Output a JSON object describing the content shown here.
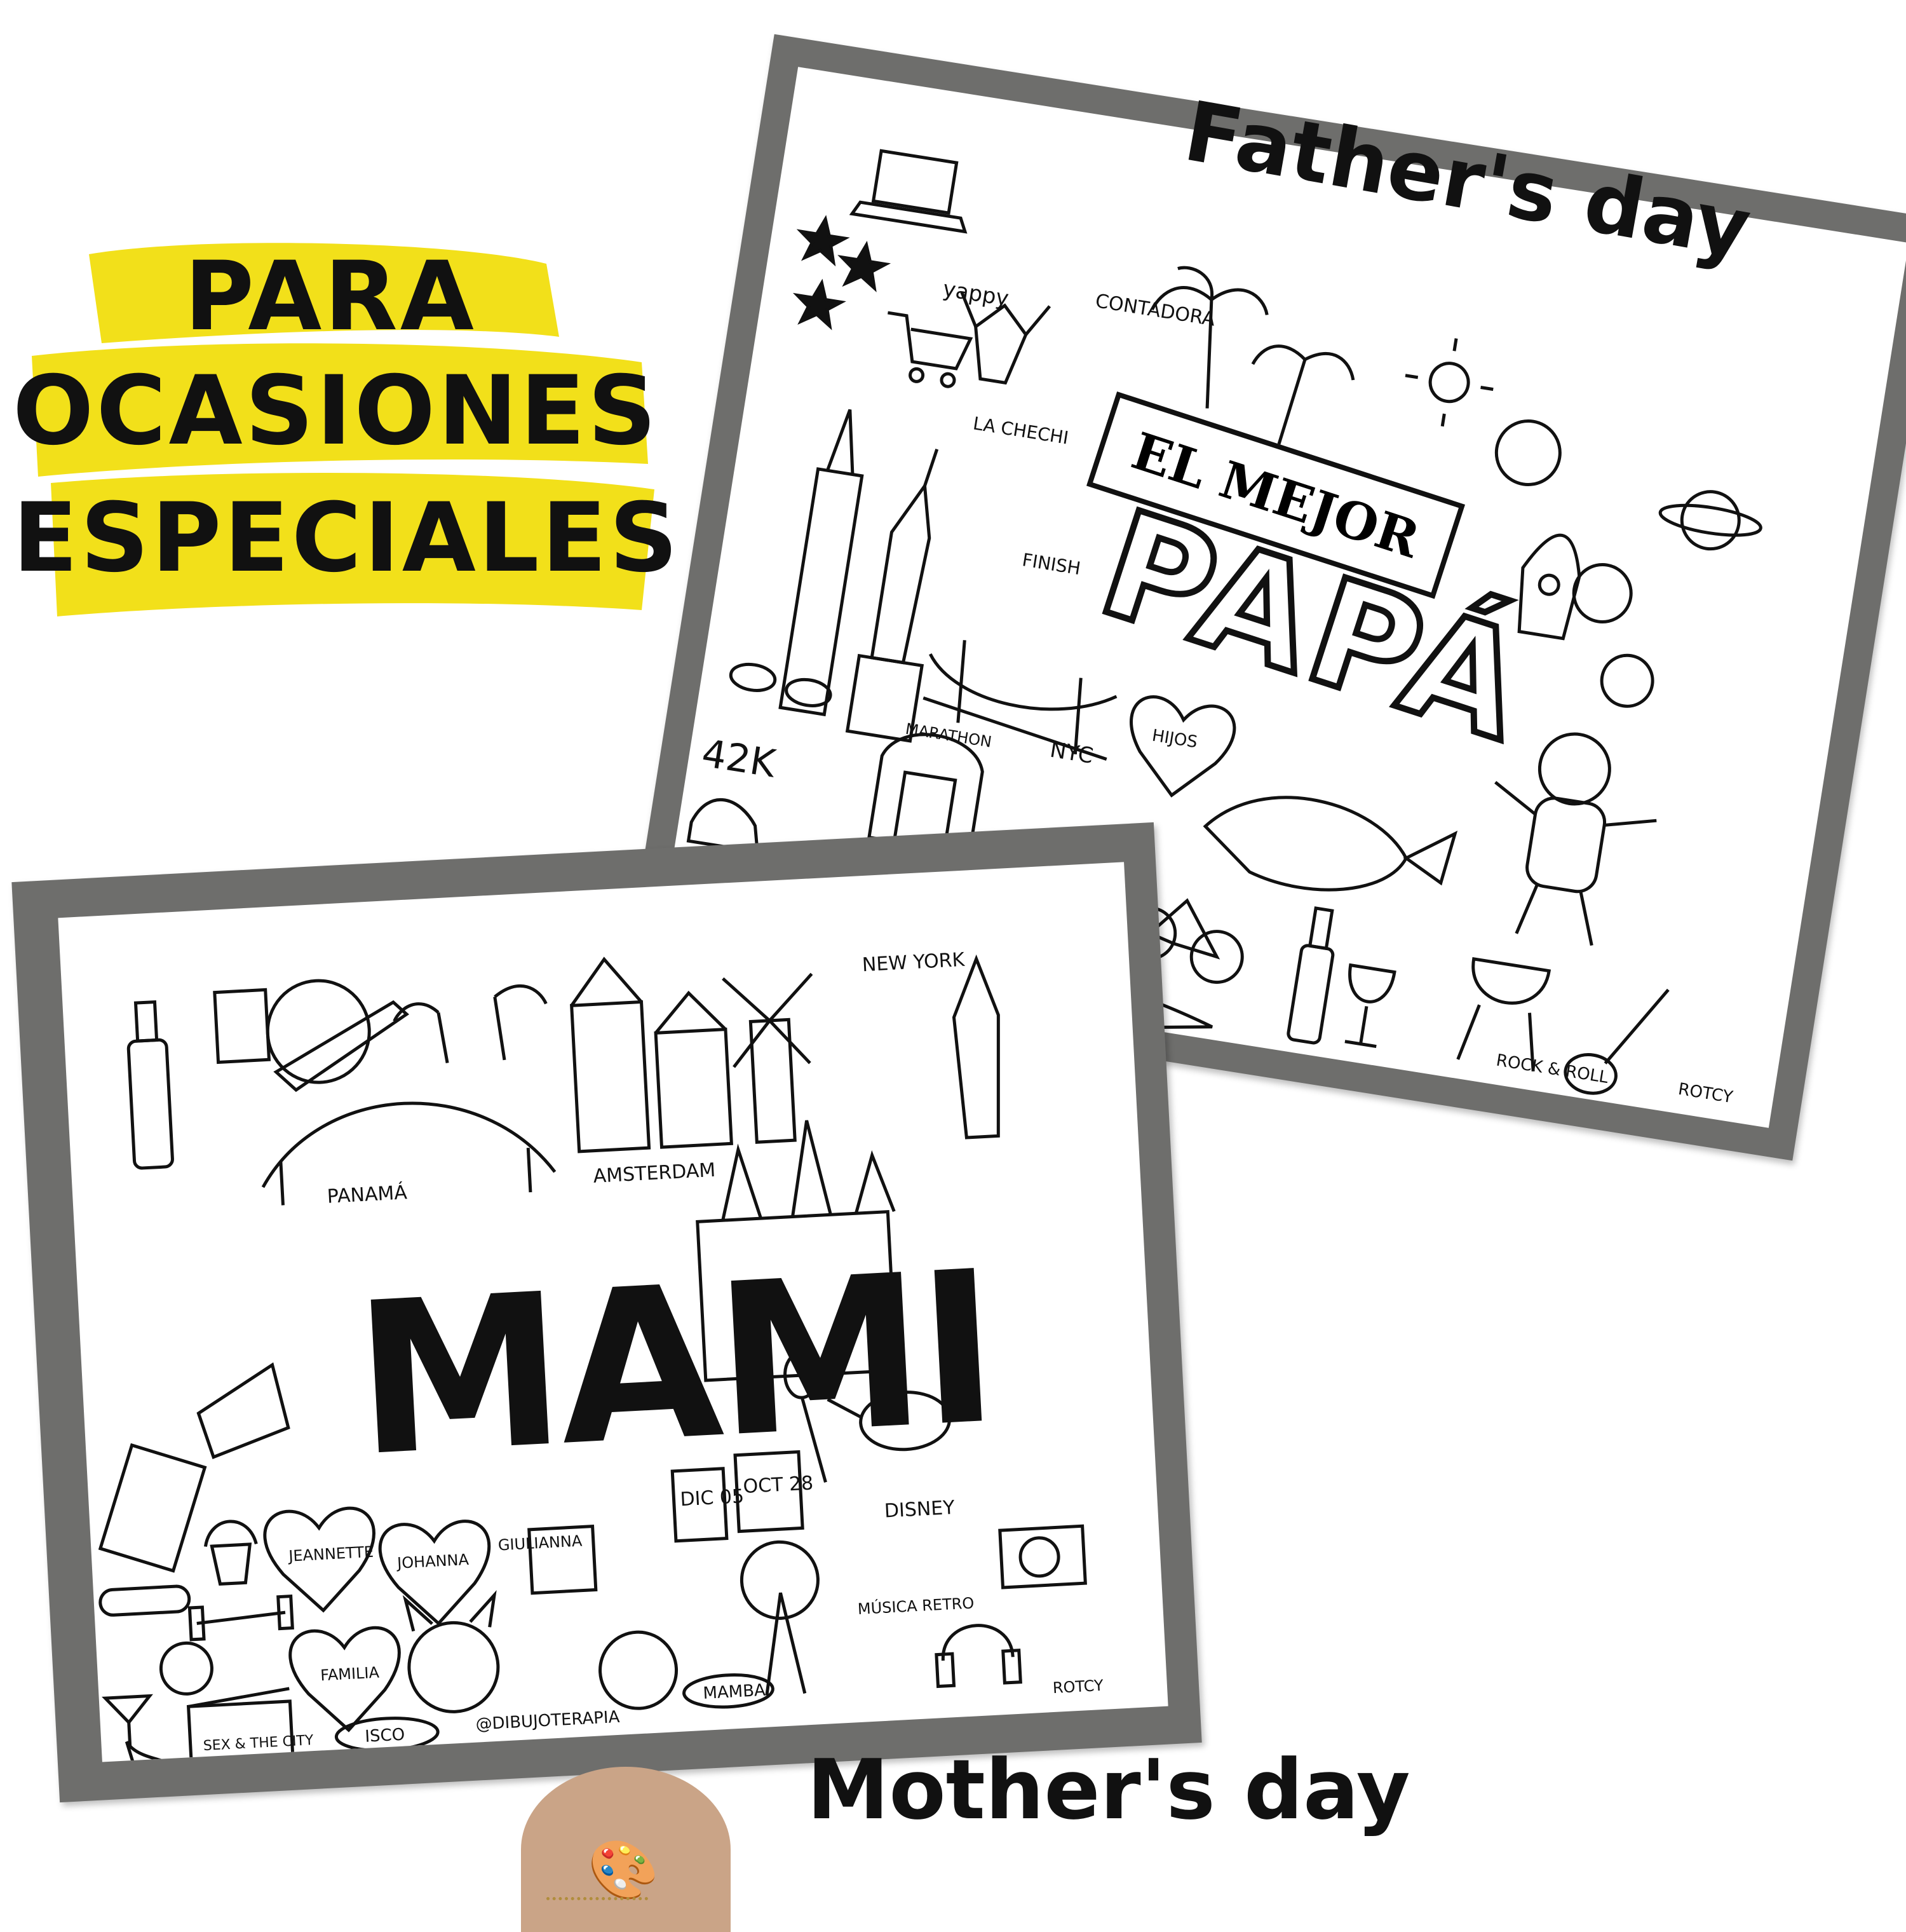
{
  "headline": {
    "line1": "PARA",
    "line2": "OCASIONES",
    "line3": "ESPECIALES",
    "highlight_color": "#f2e01a"
  },
  "labels": {
    "father": "Father's day",
    "mother": "Mother's day"
  },
  "frames": {
    "frame_color": "#6e6e6c",
    "papa": {
      "banner": "EL MEJOR",
      "title": "PAPÁ",
      "doodle_labels": [
        "yappy",
        "CONTADORA",
        "LA CHECHI",
        "FINISH",
        "HIJOS",
        "MARATHON",
        "NYC",
        "42K",
        "ROCK & ROLL",
        "ROTCY"
      ],
      "icons": [
        "laptop-icon",
        "drone-icon",
        "star-icon",
        "shopping-cart-icon",
        "deer-icon",
        "palm-tree-icon",
        "starfish-icon",
        "shell-icon",
        "sun-icon",
        "wave-icon",
        "planet-icon",
        "rocket-icon",
        "astronaut-icon",
        "statue-of-liberty-icon",
        "skyscraper-icon",
        "bridge-icon",
        "whale-icon",
        "bicycle-icon",
        "wine-bottle-icon",
        "wine-glass-icon",
        "grill-icon",
        "guitar-icon",
        "drums-icon",
        "crocodile-icon",
        "sunglasses-icon",
        "sneaker-icon",
        "heart-icon"
      ]
    },
    "mami": {
      "title": "MAMI",
      "doodle_labels": [
        "PANAMÁ",
        "AMSTERDAM",
        "NEW YORK",
        "DISNEY",
        "JEANNETTE",
        "JOHANNA",
        "GIULIANNA",
        "FAMILIA",
        "DIC 05",
        "OCT 28",
        "MÚSICA RETRO",
        "MAMBA",
        "ISCO",
        "SEX & THE CITY",
        "@DIBUJOTERAPIA",
        "ROTCY"
      ],
      "icons": [
        "wine-bottle-icon",
        "passport-icon",
        "globe-icon",
        "airplane-icon",
        "palm-tree-icon",
        "bridge-icon",
        "houses-icon",
        "windmill-icon",
        "castle-icon",
        "statue-of-liberty-icon",
        "cake-icon",
        "chocolate-icon",
        "cupcake-icon",
        "teapot-icon",
        "balloon-icon",
        "calendar-icon",
        "heart-icon",
        "dumbbell-icon",
        "kettlebell-icon",
        "yoga-mat-icon",
        "martini-icon",
        "high-heel-icon",
        "clapperboard-icon",
        "french-bulldog-icon",
        "dog-bowl-icon",
        "tree-icon",
        "headphones-icon",
        "record-player-icon",
        "gift-icon"
      ]
    }
  },
  "tattoo": "palette-icon"
}
